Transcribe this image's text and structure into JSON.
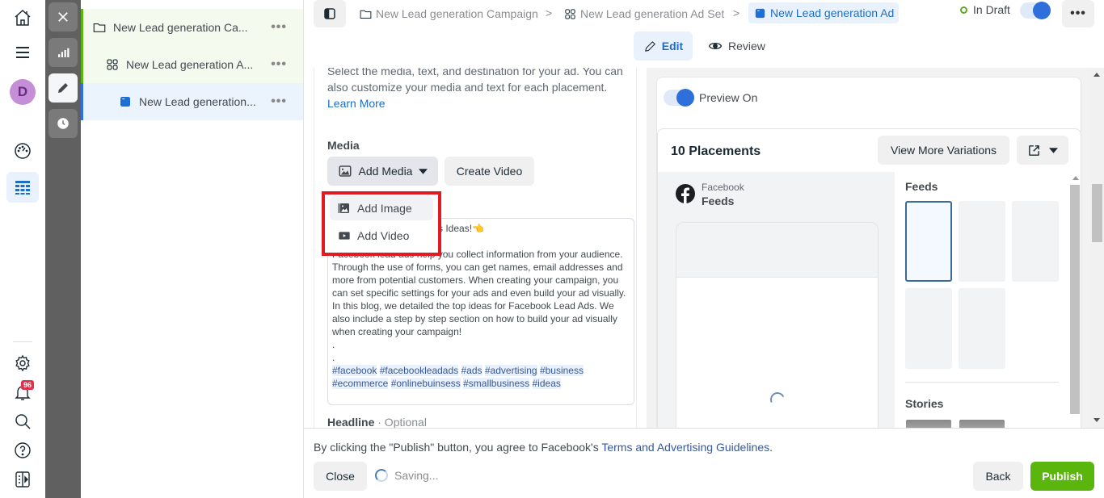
{
  "rail": {
    "avatar_initial": "D",
    "notifications_count": "96",
    "icons": [
      "home-icon",
      "menu-icon",
      "avatar",
      "dashboard-gauge-icon",
      "ads-manager-table-icon",
      "settings-gear-icon",
      "notifications-bell-icon",
      "search-icon",
      "help-icon",
      "side-panel-icon"
    ]
  },
  "tool_strip": {
    "buttons": [
      "close-icon",
      "chart-bars-icon",
      "pencil-icon",
      "clock-icon"
    ],
    "active": "pencil-icon"
  },
  "tree": {
    "items": [
      {
        "label": "New Lead generation Ca...",
        "type": "campaign",
        "more": "•••"
      },
      {
        "label": "New Lead generation A...",
        "type": "ad-set",
        "more": "•••"
      },
      {
        "label": "New Lead generation...",
        "type": "ad",
        "more": "•••"
      }
    ]
  },
  "topbar": {
    "breadcrumbs": [
      {
        "label": "New Lead generation Campaign"
      },
      {
        "label": "New Lead generation Ad Set"
      },
      {
        "label": "New Lead generation Ad"
      }
    ],
    "separator": ">",
    "status": "In Draft",
    "more": "•••",
    "modes": {
      "edit": "Edit",
      "review": "Review"
    }
  },
  "form": {
    "intro": "Select the media, text, and destination for your ad. You can also customize your media and text for each placement.",
    "learn_more": "Learn More",
    "media_label": "Media",
    "add_media": "Add Media",
    "create_video": "Create Video",
    "dropdown": {
      "items": [
        "Add Image",
        "Add Video"
      ]
    },
    "primary_text": {
      "first_line_visible": "s Ideas!",
      "emoji": "👈",
      "line2": ".",
      "body": "Facebook lead ads help you collect information from your audience. Through the use of forms, you can get names, email addresses and more from potential customers. When creating your campaign, you can set specific settings for your ads and even build your ad visually. In this blog, we detailed the top ideas for Facebook Lead Ads. We also include a step by step section on how to build your ad visually when creating your campaign!",
      "dot1": ".",
      "dot2": ".",
      "hashtags": [
        "#facebook",
        "#facebookleadads",
        "#ads",
        "#advertising",
        "#business",
        "#ecommerce",
        "#onlinebuinsess",
        "#smallbusiness",
        "#ideas"
      ]
    },
    "headline_label": "Headline",
    "headline_optional": "· Optional"
  },
  "preview": {
    "toggle_label": "Preview On",
    "toggle_on": true,
    "placements_title": "10 Placements",
    "view_more": "View More Variations",
    "platform": "Facebook",
    "placement": "Feeds",
    "thumbs_feeds_title": "Feeds",
    "thumbs_stories_title": "Stories"
  },
  "footer": {
    "terms_prefix": "By clicking the \"Publish\" button, you agree to Facebook's ",
    "terms_link": "Terms and Advertising Guidelines",
    "terms_suffix": ".",
    "close": "Close",
    "saving": "Saving...",
    "back": "Back",
    "publish": "Publish"
  },
  "colors": {
    "accent_blue": "#1d6fc4",
    "publish_green": "#5ab60d",
    "highlight_red": "#e11a24",
    "draft_green": "#5fa822",
    "strip_gray": "#606060"
  }
}
